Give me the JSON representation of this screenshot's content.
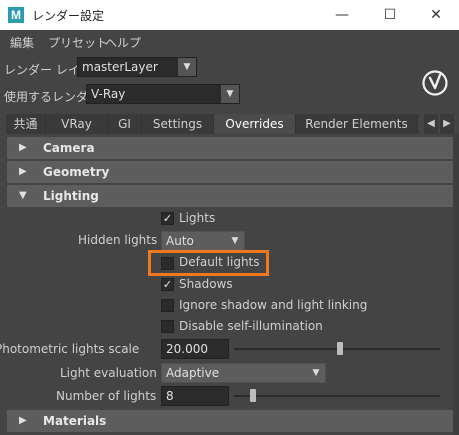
{
  "window": {
    "logo_letter": "M",
    "title": "レンダー設定",
    "minimize": "—",
    "maximize": "☐",
    "close": "✕"
  },
  "menu": {
    "edit": "編集",
    "presets": "プリセット",
    "help": "ヘルプ"
  },
  "render_layer": {
    "label": "レンダー レイヤ",
    "value": "masterLayer"
  },
  "renderer": {
    "label": "使用するレンダラ",
    "value": "V-Ray"
  },
  "tabs": [
    {
      "label": "共通"
    },
    {
      "label": "VRay"
    },
    {
      "label": "GI"
    },
    {
      "label": "Settings"
    },
    {
      "label": "Overrides",
      "active": true
    },
    {
      "label": "Render Elements"
    }
  ],
  "tab_scroll": {
    "left": "◀",
    "right": "▶"
  },
  "sections": {
    "camera": "Camera",
    "geometry": "Geometry",
    "lighting": "Lighting",
    "materials": "Materials"
  },
  "lighting": {
    "lights": {
      "label": "Lights",
      "checked": true
    },
    "hidden_lights": {
      "label": "Hidden lights",
      "value": "Auto"
    },
    "default_lights": {
      "label": "Default lights",
      "checked": false
    },
    "shadows": {
      "label": "Shadows",
      "checked": true
    },
    "ignore_shadow": {
      "label": "Ignore shadow and light linking",
      "checked": false
    },
    "disable_self_illum": {
      "label": "Disable self-illumination",
      "checked": false
    },
    "photometric_scale": {
      "label": "Photometric lights scale",
      "value": "20.000",
      "slider": 0.5
    },
    "light_evaluation": {
      "label": "Light evaluation",
      "value": "Adaptive"
    },
    "number_of_lights": {
      "label": "Number of lights",
      "value": "8",
      "slider": 0.08
    }
  },
  "colors": {
    "highlight": "#f07820",
    "background": "#444444",
    "section": "#5d5d5d"
  },
  "icons": {
    "vray_logo": "vray-logo-icon",
    "check": "✓",
    "expanded": "▼",
    "collapsed": "▶",
    "dropdown": "▼"
  }
}
